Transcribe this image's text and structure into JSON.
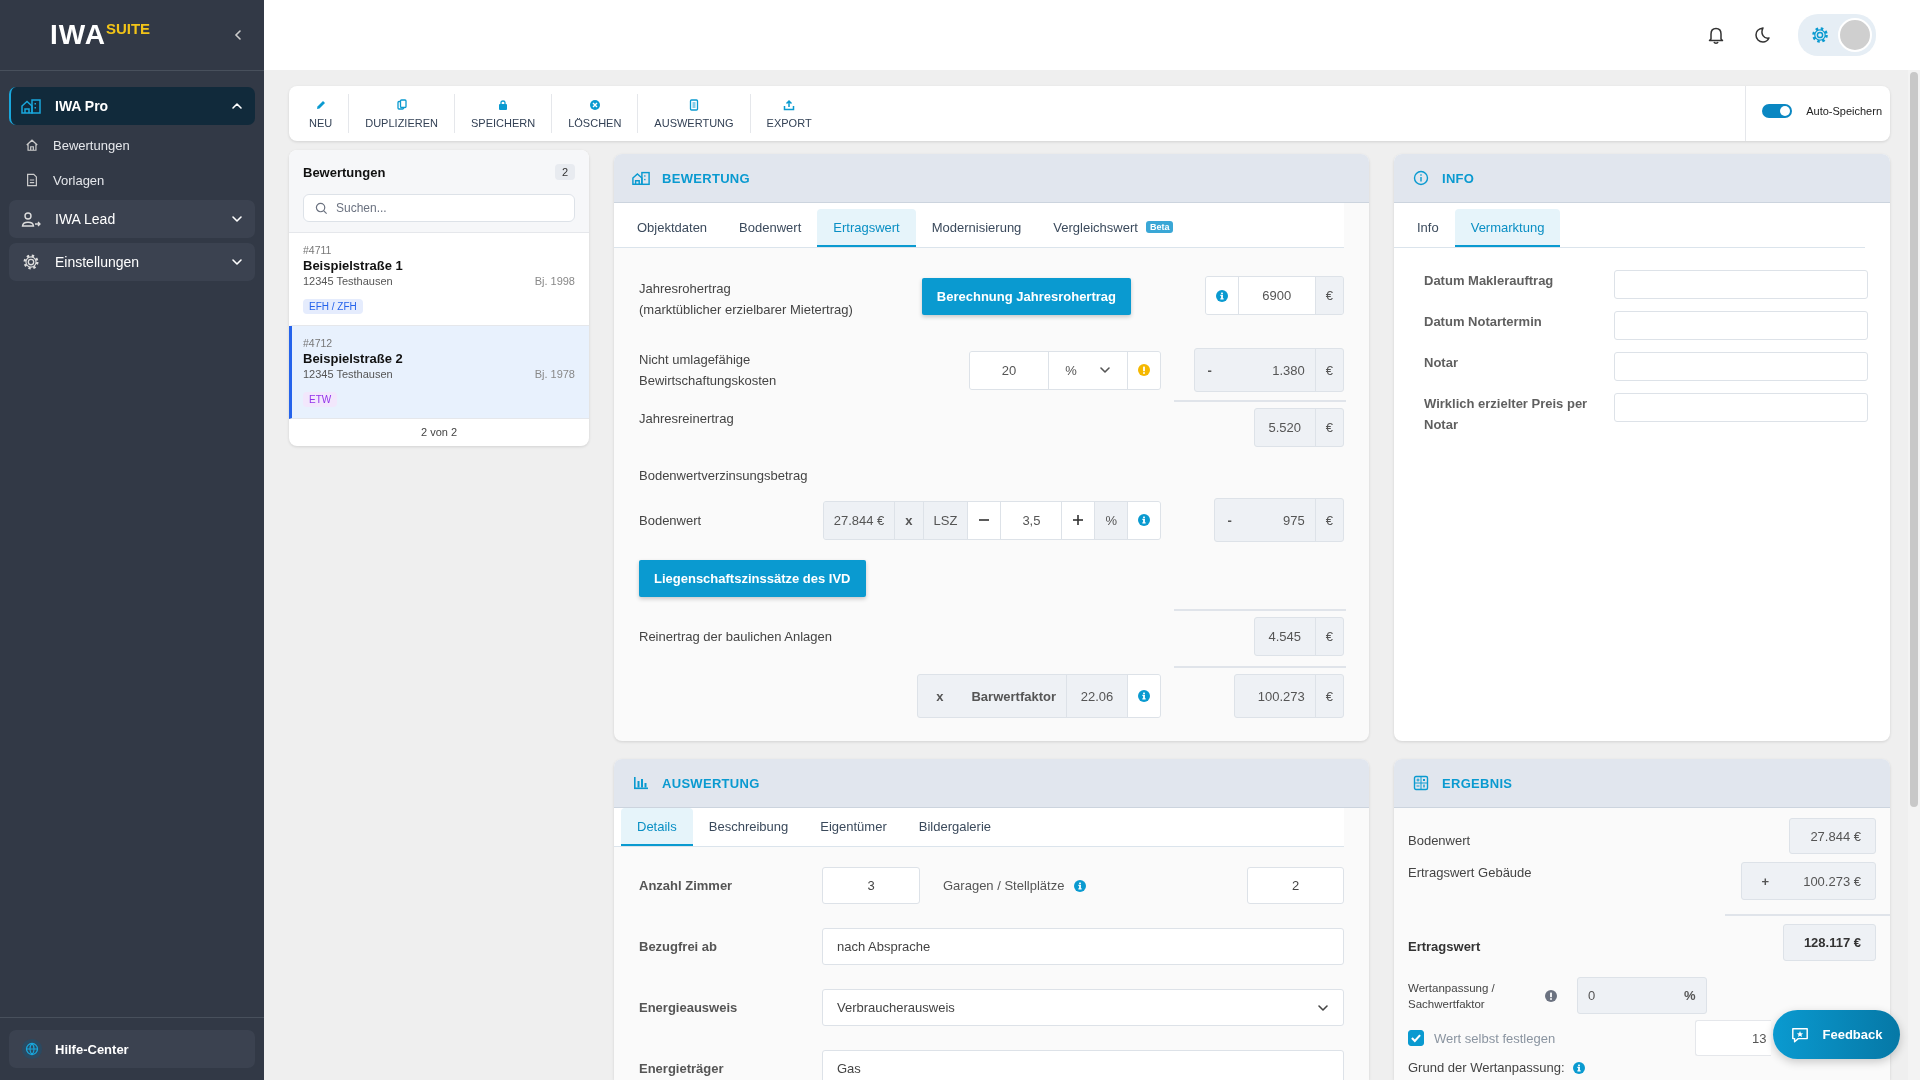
{
  "sidebar": {
    "logo": {
      "main": "IWA",
      "accent": "SUITE"
    },
    "nav": [
      {
        "label": "IWA Pro",
        "expanded": true,
        "selected": true,
        "children": [
          {
            "label": "Bewertungen"
          },
          {
            "label": "Vorlagen"
          }
        ]
      },
      {
        "label": "IWA Lead",
        "expanded": false,
        "selected": false
      },
      {
        "label": "Einstellungen",
        "expanded": false,
        "selected": false
      }
    ],
    "help": "Hilfe-Center"
  },
  "toolbar": {
    "actions": [
      "NEU",
      "DUPLIZIEREN",
      "SPEICHERN",
      "LÖSCHEN",
      "AUSWERTUNG",
      "EXPORT"
    ],
    "auto_save": {
      "label": "Auto-Speichern",
      "on": true
    }
  },
  "list": {
    "title": "Bewertungen",
    "count": "2",
    "search": {
      "placeholder": "Suchen..."
    },
    "items": [
      {
        "number": "#4711",
        "title": "Beispielstraße 1",
        "city": "12345 Testhausen",
        "year": "Bj. 1998",
        "tag": "EFH / ZFH",
        "color": "#2563eb",
        "selected": false
      },
      {
        "number": "#4712",
        "title": "Beispielstraße 2",
        "city": "12345 Testhausen",
        "year": "Bj. 1978",
        "tag": "ETW",
        "color": "#9333ea",
        "selected": true
      }
    ],
    "footer": "2 von 2"
  },
  "valuation": {
    "title": "BEWERTUNG",
    "tabs": [
      {
        "label": "Objektdaten",
        "selected": false
      },
      {
        "label": "Bodenwert",
        "selected": false
      },
      {
        "label": "Ertragswert",
        "selected": true
      },
      {
        "label": "Modernisierung",
        "selected": false
      },
      {
        "label": "Vergleichswert",
        "selected": false,
        "badge": "Beta"
      }
    ],
    "calc": {
      "gross": {
        "label": "Jahresrohertrag",
        "note": "(marktüblicher erzielbarer Mietertrag)",
        "button": "Berechnung Jahresrohertrag",
        "value": "6900",
        "unit": "€"
      },
      "costs": {
        "label": "Nicht umlagefähige Bewirtschaftungskosten",
        "value": "20",
        "unit_select": "%",
        "sign": "-",
        "result": "1.380",
        "unit": "€"
      },
      "net": {
        "label": "Jahresreinertrag",
        "value": "5.520",
        "unit": "€"
      },
      "interest_heading": "Bodenwertverzinsungsbetrag",
      "land": {
        "label": "Bodenwert",
        "base": "27.844 €",
        "times": "x",
        "rate_label": "LSZ",
        "rate": "3,5",
        "percent": "%",
        "sign": "-",
        "result": "975",
        "unit": "€"
      },
      "ivd_button": "Liegenschaftszinssätze des IVD",
      "building_net": {
        "label": "Reinertrag der baulichen Anlagen",
        "value": "4.545",
        "unit": "€"
      },
      "factor": {
        "times": "x",
        "label": "Barwertfaktor",
        "value": "22.06",
        "result": "100.273",
        "unit": "€"
      }
    }
  },
  "info": {
    "title": "INFO",
    "tabs": [
      {
        "label": "Info",
        "selected": false
      },
      {
        "label": "Vermarktung",
        "selected": true
      }
    ],
    "fields": [
      {
        "label": "Datum Maklerauftrag"
      },
      {
        "label": "Datum Notartermin"
      },
      {
        "label": "Notar"
      },
      {
        "label": "Wirklich erzielter Preis per Notar"
      }
    ]
  },
  "report": {
    "title": "AUSWERTUNG",
    "tabs": [
      {
        "label": "Details",
        "selected": true
      },
      {
        "label": "Beschreibung",
        "selected": false
      },
      {
        "label": "Eigentümer",
        "selected": false
      },
      {
        "label": "Bildergalerie",
        "selected": false
      }
    ],
    "rooms": {
      "label": "Anzahl Zimmer",
      "value": "3"
    },
    "garages": {
      "label": "Garagen / Stellplätze",
      "value": "2"
    },
    "fields": [
      {
        "kind": "text",
        "label": "Bezugfrei ab",
        "value": "nach Absprache"
      },
      {
        "kind": "select",
        "label": "Energieausweis",
        "value": "Verbraucherausweis"
      },
      {
        "kind": "text",
        "label": "Energieträger",
        "value": "Gas"
      }
    ]
  },
  "result": {
    "title": "ERGEBNIS",
    "land": {
      "label": "Bodenwert",
      "value": "27.844 €"
    },
    "building": {
      "label": "Ertragswert Gebäude",
      "sign": "+",
      "value": "100.273 €"
    },
    "total": {
      "label": "Ertragswert",
      "value": "128.117 €"
    },
    "adjustment": {
      "label": "Wertanpassung / Sachwertfaktor",
      "value": "0",
      "unit": "%"
    },
    "override": {
      "label": "Wert selbst festlegen",
      "checked": true,
      "value": "13"
    },
    "reason": {
      "label": "Grund der Wertanpassung:"
    }
  },
  "feedback": "Feedback"
}
